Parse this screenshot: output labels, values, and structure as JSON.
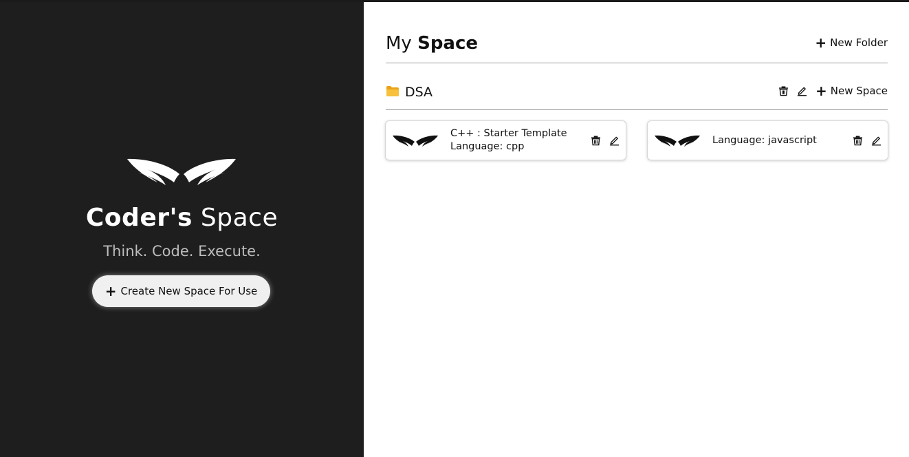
{
  "brand": {
    "title_strong": "Coder's",
    "title_light": "Space",
    "tagline": "Think. Code. Execute.",
    "create_button_label": "Create New Space For Use",
    "logo_icon": "wings-logo-icon"
  },
  "header": {
    "title_prefix": "My",
    "title_bold": "Space",
    "new_folder_label": "New Folder"
  },
  "folders": [
    {
      "name": "DSA",
      "icon": "folder-icon",
      "new_space_label": "New Space",
      "spaces": [
        {
          "title": "C++ : Starter Template",
          "language": "Language: cpp"
        },
        {
          "title": "",
          "language": "Language: javascript"
        }
      ]
    }
  ],
  "colors": {
    "left_panel_bg": "#1e1e1e",
    "folder_icon": "#f6b928",
    "button_bg": "#f0f0f0"
  }
}
